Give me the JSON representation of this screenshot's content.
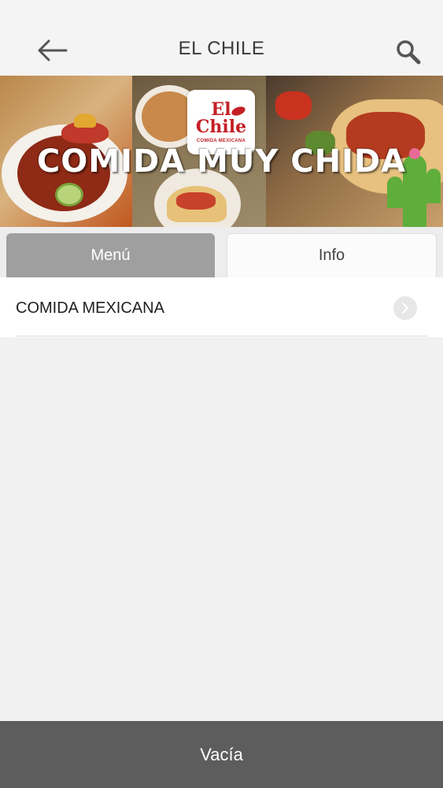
{
  "header": {
    "title": "EL CHILE",
    "back_icon": "arrow-left-icon",
    "search_icon": "search-icon"
  },
  "banner": {
    "logo_text_line1": "El",
    "logo_text_line2": "Chile",
    "logo_subtitle": "COMIDA MEXICANA",
    "tagline": "COMIDA MUY CHIDA"
  },
  "tabs": [
    {
      "label": "Menú",
      "selected": true
    },
    {
      "label": "Info",
      "selected": false
    }
  ],
  "menu": {
    "items": [
      {
        "label": "COMIDA MEXICANA",
        "icon": "chevron-right-icon"
      }
    ]
  },
  "footer": {
    "cart_label": "Vacía"
  },
  "colors": {
    "header_bg": "#f4f4f4",
    "tab_selected_bg": "#9f9f9f",
    "tab_unselected_bg": "#fbfbfb",
    "footer_bg": "#5d5d5d",
    "logo_red": "#c42026",
    "page_bg": "#f2f1f2"
  }
}
